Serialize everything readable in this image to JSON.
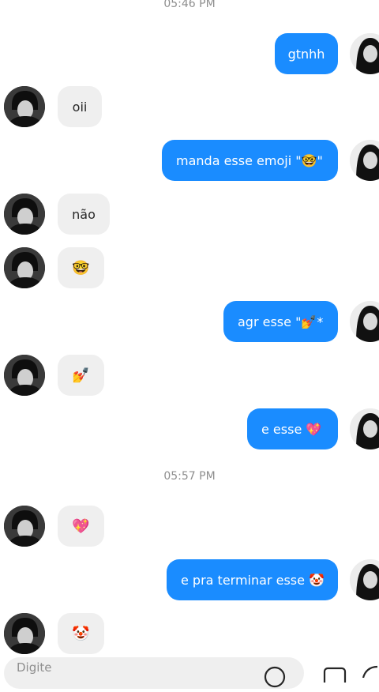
{
  "timestamps": [
    "05:46 PM",
    "05:57 PM"
  ],
  "messages": [
    {
      "side": "out",
      "text": "gtnhh"
    },
    {
      "side": "in",
      "text": "oii"
    },
    {
      "side": "out",
      "text": "manda esse emoji \"🤓\""
    },
    {
      "side": "in",
      "text": "não"
    },
    {
      "side": "in",
      "text": "🤓"
    },
    {
      "side": "out",
      "text": "agr esse \"💅*"
    },
    {
      "side": "in",
      "text": "💅"
    },
    {
      "side": "out",
      "text": "e esse 💖"
    },
    {
      "side": "in",
      "text": "💖"
    },
    {
      "side": "out",
      "text": "e pra terminar esse 🤡"
    },
    {
      "side": "in",
      "text": "🤡"
    }
  ],
  "composer": {
    "placeholder": "Digite"
  },
  "icons": {
    "emoji_button": "emoji-icon",
    "gallery_button": "image-icon",
    "sticker_button": "sticker-icon"
  },
  "colors": {
    "outgoing_bubble": "#1a8cff",
    "incoming_bubble": "#efefef"
  }
}
